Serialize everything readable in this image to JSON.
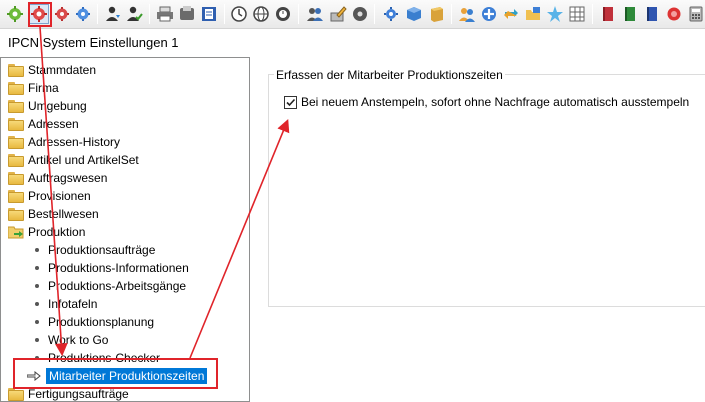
{
  "window": {
    "title": "IPCN System Einstellungen 1"
  },
  "toolbar": {
    "buttons": [
      {
        "icon": "green-gear-icon"
      },
      {
        "icon": "red-gear-icon",
        "selected": true
      },
      {
        "icon": "red-gear-small-icon"
      },
      {
        "icon": "blue-gear-icon"
      },
      {
        "icon": "user-download-icon"
      },
      {
        "icon": "user-check-icon"
      },
      {
        "icon": "printer-icon"
      },
      {
        "icon": "fax-icon"
      },
      {
        "icon": "document-icon"
      },
      {
        "icon": "clock-icon"
      },
      {
        "icon": "globe-icon"
      },
      {
        "icon": "clock-counter-icon"
      },
      {
        "icon": "users-icon"
      },
      {
        "icon": "pen-icon"
      },
      {
        "icon": "disc-icon"
      },
      {
        "icon": "tools-icon"
      },
      {
        "icon": "blue-cube-icon"
      },
      {
        "icon": "box-icon"
      },
      {
        "icon": "user-group-icon"
      },
      {
        "icon": "plus-circle-icon"
      },
      {
        "icon": "sync-icon"
      },
      {
        "icon": "folder-icon"
      },
      {
        "icon": "star-icon"
      },
      {
        "icon": "grid-icon"
      },
      {
        "icon": "red-book-icon"
      },
      {
        "icon": "green-book-icon"
      },
      {
        "icon": "blue-book-icon"
      },
      {
        "icon": "eraser-icon"
      },
      {
        "icon": "calculator-icon"
      }
    ]
  },
  "tree": {
    "items": [
      {
        "label": "Stammdaten",
        "type": "folder"
      },
      {
        "label": "Firma",
        "type": "folder"
      },
      {
        "label": "Umgebung",
        "type": "folder"
      },
      {
        "label": "Adressen",
        "type": "folder"
      },
      {
        "label": "Adressen-History",
        "type": "folder"
      },
      {
        "label": "Artikel und ArtikelSet",
        "type": "folder"
      },
      {
        "label": "Auftragswesen",
        "type": "folder"
      },
      {
        "label": "Provisionen",
        "type": "folder"
      },
      {
        "label": "Bestellwesen",
        "type": "folder"
      },
      {
        "label": "Produktion",
        "type": "open-folder"
      },
      {
        "label": "Produktionsaufträge",
        "type": "child"
      },
      {
        "label": "Produktions-Informationen",
        "type": "child"
      },
      {
        "label": "Produktions-Arbeitsgänge",
        "type": "child"
      },
      {
        "label": "Infotafeln",
        "type": "child"
      },
      {
        "label": "Produktionsplanung",
        "type": "child"
      },
      {
        "label": "Work to Go",
        "type": "child"
      },
      {
        "label": "Produktions-Checker",
        "type": "child"
      },
      {
        "label": "Mitarbeiter Produktionszeiten",
        "type": "selected"
      },
      {
        "label": "Fertigungsaufträge",
        "type": "folder"
      }
    ]
  },
  "settings": {
    "group_title": "Erfassen der Mitarbeiter Produktionszeiten",
    "checkbox_label": "Bei neuem Anstempeln, sofort ohne Nachfrage automatisch ausstempeln",
    "checkbox_checked": true
  },
  "colors": {
    "annotation": "#e0242a",
    "selection": "#0078d7"
  }
}
